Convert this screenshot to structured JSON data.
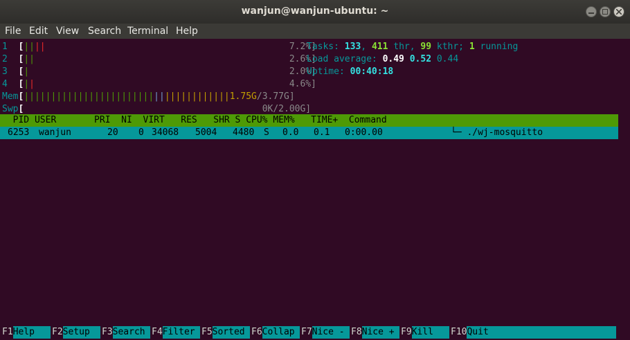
{
  "window": {
    "title": "wanjun@wanjun-ubuntu: ~"
  },
  "menu": [
    "File",
    "Edit",
    "View",
    "Search",
    "Terminal",
    "Help"
  ],
  "meters": {
    "cpu": [
      {
        "id": "1",
        "pct": "7.2%]"
      },
      {
        "id": "2",
        "pct": "2.6%]"
      },
      {
        "id": "3",
        "pct": "2.0%]"
      },
      {
        "id": "4",
        "pct": "4.6%]"
      }
    ],
    "mem": {
      "label": "Mem",
      "value": "1.75G",
      "total": "/3.77G]"
    },
    "swp": {
      "label": "Swp",
      "value": "0K/2.00G]"
    }
  },
  "stats": {
    "tasks_label": "Tasks:",
    "tasks": "133",
    "thr": "411",
    "thr_label": "thr,",
    "kthr": "99",
    "kthr_label": "kthr;",
    "running": "1",
    "running_label": "running",
    "load_label": "Load average:",
    "load1": "0.49",
    "load5": "0.52",
    "load15": "0.44",
    "uptime_label": "Uptime:",
    "uptime": "00:40:18"
  },
  "table": {
    "header": "  PID USER       PRI  NI  VIRT   RES   SHR S CPU% MEM%   TIME+  Command",
    "row": {
      "pid": "6253",
      "user": "wanjun",
      "pri": "20",
      "ni": "0",
      "virt": "34068",
      "res": "5004",
      "shr": "4480",
      "s": "S",
      "cpu": "0.0",
      "mem": "0.1",
      "time": "0:00.00",
      "command": "└─ ./wj-mosquitto"
    }
  },
  "fkeys": [
    {
      "key": "F1",
      "label": "Help  "
    },
    {
      "key": "F2",
      "label": "Setup "
    },
    {
      "key": "F3",
      "label": "Search"
    },
    {
      "key": "F4",
      "label": "Filter"
    },
    {
      "key": "F5",
      "label": "Sorted"
    },
    {
      "key": "F6",
      "label": "Collap"
    },
    {
      "key": "F7",
      "label": "Nice -"
    },
    {
      "key": "F8",
      "label": "Nice +"
    },
    {
      "key": "F9",
      "label": "Kill  "
    },
    {
      "key": "F10",
      "label": "Quit  "
    }
  ]
}
